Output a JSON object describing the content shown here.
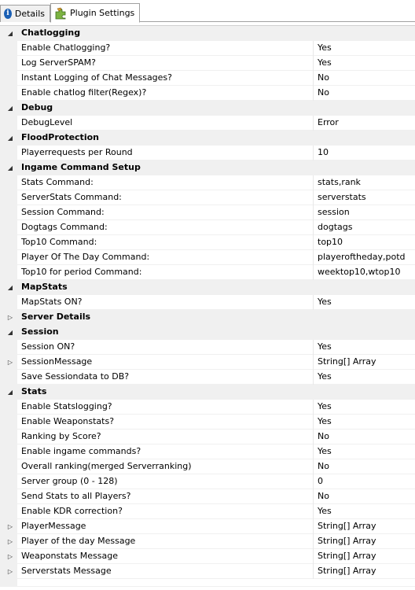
{
  "tabs": {
    "details": "Details",
    "plugin_settings": "Plugin Settings"
  },
  "icons": {
    "details": "info-icon",
    "plugin_settings": "puzzle-icon"
  },
  "rows": [
    {
      "type": "category",
      "name": "Chatlogging",
      "expanded": true
    },
    {
      "type": "prop",
      "name": "Enable Chatlogging?",
      "value": "Yes"
    },
    {
      "type": "prop",
      "name": "Log ServerSPAM?",
      "value": "Yes"
    },
    {
      "type": "prop",
      "name": "Instant Logging of Chat Messages?",
      "value": "No"
    },
    {
      "type": "prop",
      "name": "Enable chatlog filter(Regex)?",
      "value": "No"
    },
    {
      "type": "category",
      "name": "Debug",
      "expanded": true
    },
    {
      "type": "prop",
      "name": "DebugLevel",
      "value": "Error"
    },
    {
      "type": "category",
      "name": "FloodProtection",
      "expanded": true
    },
    {
      "type": "prop",
      "name": "Playerrequests per Round",
      "value": "10"
    },
    {
      "type": "category",
      "name": "Ingame Command Setup",
      "expanded": true
    },
    {
      "type": "prop",
      "name": "Stats Command:",
      "value": "stats,rank"
    },
    {
      "type": "prop",
      "name": "ServerStats Command:",
      "value": "serverstats"
    },
    {
      "type": "prop",
      "name": "Session Command:",
      "value": "session"
    },
    {
      "type": "prop",
      "name": "Dogtags Command:",
      "value": "dogtags"
    },
    {
      "type": "prop",
      "name": "Top10 Command:",
      "value": "top10"
    },
    {
      "type": "prop",
      "name": "Player Of The Day Command:",
      "value": "playeroftheday,potd"
    },
    {
      "type": "prop",
      "name": "Top10 for period Command:",
      "value": "weektop10,wtop10"
    },
    {
      "type": "category",
      "name": "MapStats",
      "expanded": true
    },
    {
      "type": "prop",
      "name": "MapStats ON?",
      "value": "Yes"
    },
    {
      "type": "category",
      "name": "Server Details",
      "expanded": false
    },
    {
      "type": "category",
      "name": "Session",
      "expanded": true
    },
    {
      "type": "prop",
      "name": "Session ON?",
      "value": "Yes"
    },
    {
      "type": "prop",
      "name": "SessionMessage",
      "value": "String[] Array",
      "expandable": true
    },
    {
      "type": "prop",
      "name": "Save Sessiondata to DB?",
      "value": "Yes"
    },
    {
      "type": "category",
      "name": "Stats",
      "expanded": true
    },
    {
      "type": "prop",
      "name": "Enable Statslogging?",
      "value": "Yes"
    },
    {
      "type": "prop",
      "name": "Enable Weaponstats?",
      "value": "Yes"
    },
    {
      "type": "prop",
      "name": "Ranking by Score?",
      "value": "No"
    },
    {
      "type": "prop",
      "name": "Enable ingame commands?",
      "value": "Yes"
    },
    {
      "type": "prop",
      "name": "Overall ranking(merged Serverranking)",
      "value": "No"
    },
    {
      "type": "prop",
      "name": "Server group (0 - 128)",
      "value": "0"
    },
    {
      "type": "prop",
      "name": "Send Stats to all Players?",
      "value": "No"
    },
    {
      "type": "prop",
      "name": "Enable KDR correction?",
      "value": "Yes"
    },
    {
      "type": "prop",
      "name": "PlayerMessage",
      "value": "String[] Array",
      "expandable": true
    },
    {
      "type": "prop",
      "name": "Player of the day Message",
      "value": "String[] Array",
      "expandable": true
    },
    {
      "type": "prop",
      "name": "Weaponstats Message",
      "value": "String[] Array",
      "expandable": true
    },
    {
      "type": "prop",
      "name": "Serverstats Message",
      "value": "String[] Array",
      "expandable": true
    }
  ]
}
